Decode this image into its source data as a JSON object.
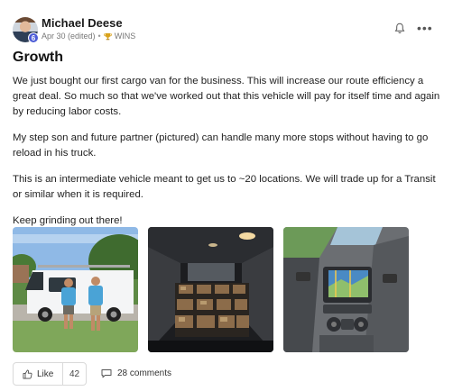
{
  "post": {
    "author": "Michael Deese",
    "level": "6",
    "date": "Apr 30 (edited)",
    "separator": "•",
    "badge_label": "WINS",
    "title": "Growth",
    "paragraphs": [
      "We just bought our first cargo van for the business. This will increase our route efficiency a great deal. So much so that we've worked out that this vehicle will pay for itself time and again by reducing labor costs.",
      "My step son and future partner (pictured) can handle many more stops without having to go reload in his truck.",
      "This is an intermediate vehicle meant to get us to ~20 locations. We will trade up for a Transit or similar when it is required.",
      "Keep grinding out there!"
    ]
  },
  "actions": {
    "like_label": "Like",
    "like_count": "42",
    "comments_label": "28 comments"
  },
  "icons": {
    "bell": "bell-icon",
    "more": "more-options-icon",
    "trophy": "trophy-icon",
    "like": "thumbs-up-icon",
    "comment": "comment-icon"
  },
  "colors": {
    "level_badge": "#4b5bd6",
    "trophy": "#d9a21b"
  }
}
